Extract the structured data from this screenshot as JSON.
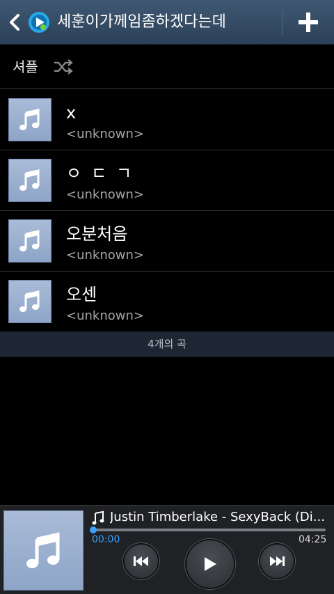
{
  "header": {
    "title": "세훈이가께임좀하겠다는데",
    "icons": {
      "back": "chevron-left-icon",
      "app": "music-player-logo-icon",
      "add": "plus-icon"
    }
  },
  "shuffle": {
    "label": "셔플",
    "icon": "shuffle-icon"
  },
  "songs": [
    {
      "title": "x",
      "artist": "<unknown>"
    },
    {
      "title": "ㅇㄷㄱ",
      "artist": "<unknown>"
    },
    {
      "title": "오분처음",
      "artist": "<unknown>"
    },
    {
      "title": "오센",
      "artist": "<unknown>"
    }
  ],
  "song_count": "4개의 곡",
  "player": {
    "now_playing": "Justin Timberlake - SexyBack (Di...",
    "current_time": "00:00",
    "total_time": "04:25",
    "progress": 0.0,
    "controls": {
      "prev": "previous-icon",
      "play": "play-icon",
      "next": "next-icon"
    }
  },
  "colors": {
    "header_bg": "#34495f",
    "accent": "#3ba1ff",
    "thumb_bg": "#9db1d1",
    "count_bar_bg": "#1d2632"
  }
}
